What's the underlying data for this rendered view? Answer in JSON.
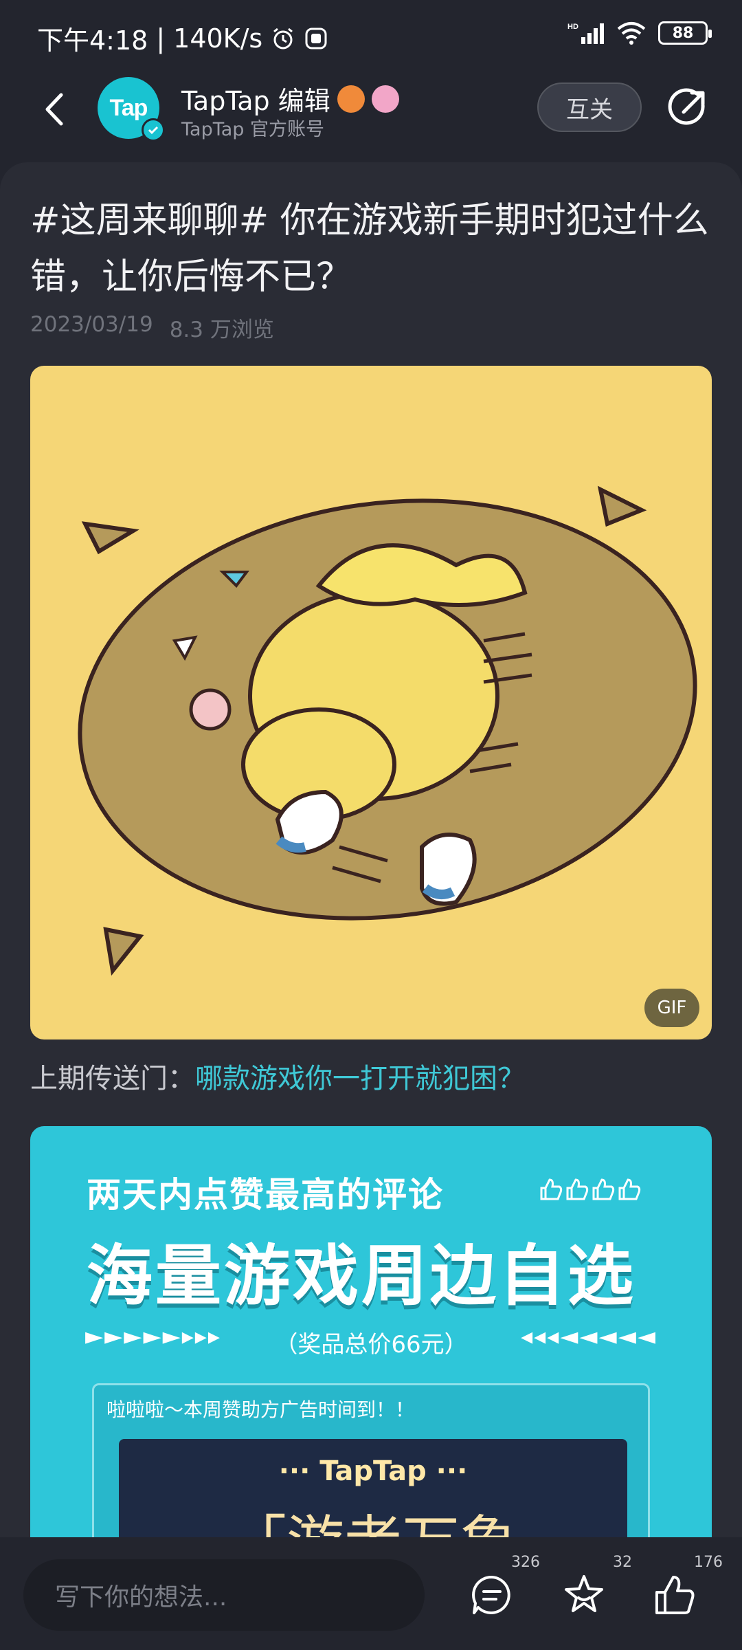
{
  "status_bar": {
    "time": "下午4:18",
    "network_speed": "140K/s",
    "battery": "88",
    "signal_label": "HD"
  },
  "header": {
    "avatar_text": "Tap",
    "account_name": "TapTap 编辑",
    "account_sub": "TapTap 官方账号",
    "follow_label": "互关"
  },
  "post": {
    "title": "#这周来聊聊# 你在游戏新手期时犯过什么错，让你后悔不已？",
    "date": "2023/03/19",
    "views": "8.3 万浏览",
    "gif_badge": "GIF",
    "prev_prefix": "上期传送门：",
    "prev_link": "哪款游戏你一打开就犯困？"
  },
  "banner": {
    "line1": "两天内点赞最高的评论",
    "line2": "海量游戏周边自选",
    "line3": "（奖品总价66元）",
    "arrows_left": "►►►►►▸▸▸",
    "arrows_right": "◂◂◂◄◄◄◄◄",
    "ad_title": "啦啦啦～本周赞助方广告时间到！！",
    "ad_brand": "··· TapTap ···",
    "ad_game": "「游者万象"
  },
  "bottom_bar": {
    "comment_placeholder": "写下你的想法...",
    "comments_count": "326",
    "favorites_count": "32",
    "likes_count": "176"
  },
  "colors": {
    "background": "#23252e",
    "card": "#2a2c35",
    "accent": "#3fc8d6",
    "gif_bg": "#f5d676",
    "banner_bg": "#2ec6d9"
  }
}
